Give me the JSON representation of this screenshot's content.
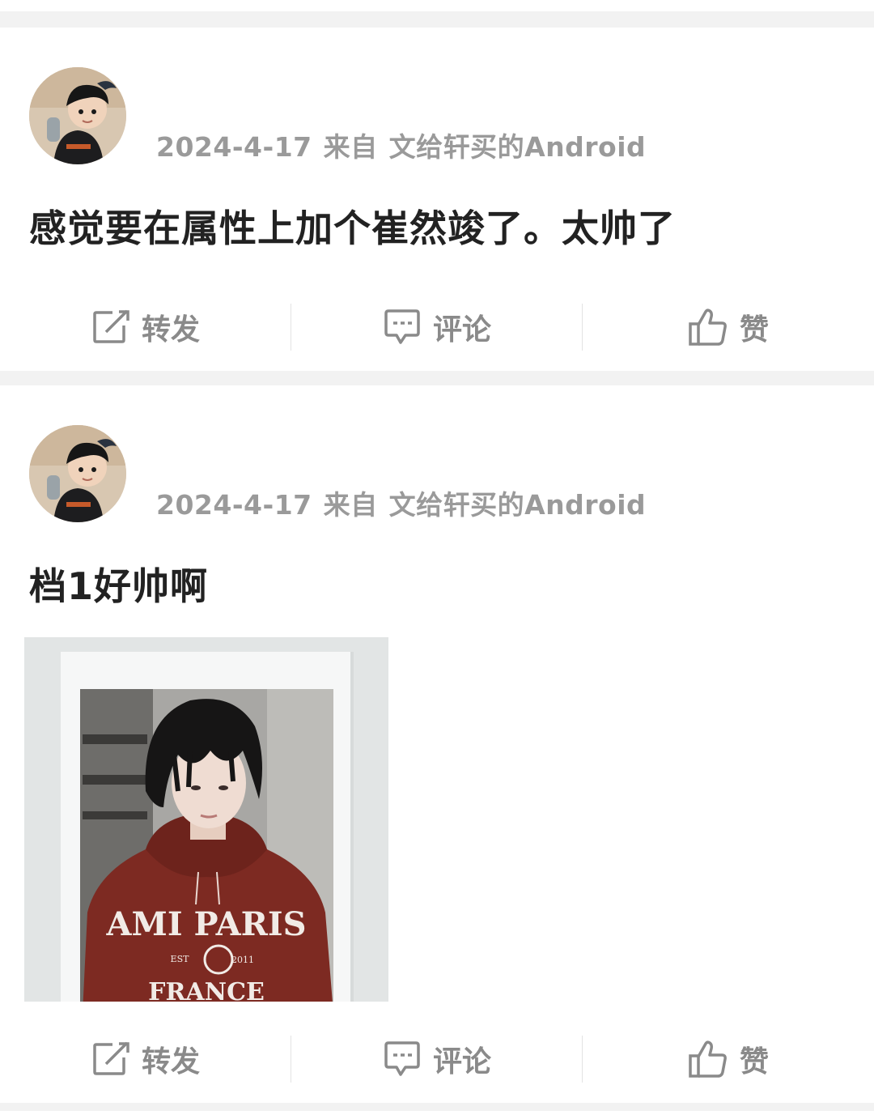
{
  "posts": [
    {
      "date": "2024-4-17",
      "from_label": "来自",
      "source": "文给轩买的Android",
      "text": "感觉要在属性上加个崔然竣了。太帅了",
      "actions": {
        "repost": "转发",
        "comment": "评论",
        "like": "赞"
      }
    },
    {
      "date": "2024-4-17",
      "from_label": "来自",
      "source": "文给轩买的Android",
      "text": "档1好帅啊",
      "image": {
        "hoodie_text_top": "AMI PARIS",
        "hoodie_est": "EST",
        "hoodie_year": "2011",
        "hoodie_text_bottom": "FRANCE"
      },
      "actions": {
        "repost": "转发",
        "comment": "评论",
        "like": "赞"
      }
    }
  ],
  "colors": {
    "page_bg": "#f2f2f2",
    "card_bg": "#ffffff",
    "meta_text": "#9a9a9a",
    "post_text": "#222222",
    "action_text": "#8a8a8a",
    "icon_stroke": "#8a8a8a"
  },
  "icons": {
    "repost": "edit-square-icon",
    "comment": "comment-bubble-icon",
    "like": "thumbs-up-icon"
  }
}
